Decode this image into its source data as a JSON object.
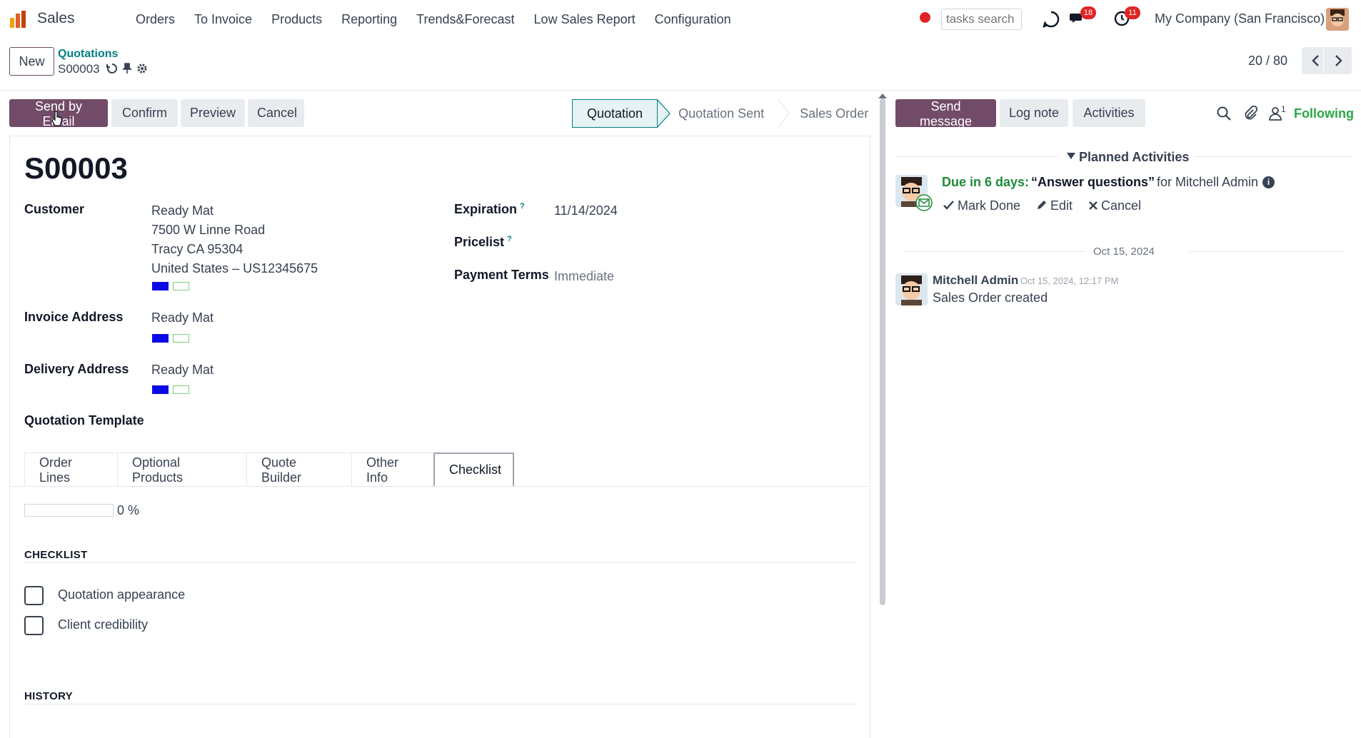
{
  "topnav": {
    "app_name": "Sales",
    "menu": [
      "Orders",
      "To Invoice",
      "Products",
      "Reporting",
      "Trends&Forecast",
      "Low Sales Report",
      "Configuration"
    ],
    "search_placeholder": "tasks search",
    "messages_count": "18",
    "activities_count": "11",
    "company": "My Company (San Francisco)"
  },
  "control_panel": {
    "new_label": "New",
    "breadcrumb_parent": "Quotations",
    "breadcrumb_record": "S00003",
    "pager_value": "20 / 80"
  },
  "actions": {
    "send_by_email": "Send by Email",
    "confirm": "Confirm",
    "preview": "Preview",
    "cancel": "Cancel"
  },
  "statusbar": {
    "stages": [
      "Quotation",
      "Quotation Sent",
      "Sales Order"
    ],
    "active": "Quotation"
  },
  "form": {
    "name": "S00003",
    "customer_label": "Customer",
    "customer_lines": [
      "Ready Mat",
      "7500 W Linne Road",
      "Tracy CA 95304",
      "United States – US12345675"
    ],
    "invoice_label": "Invoice Address",
    "invoice_value": "Ready Mat",
    "delivery_label": "Delivery Address",
    "delivery_value": "Ready Mat",
    "template_label": "Quotation Template",
    "expiration_label": "Expiration",
    "expiration_value": "11/14/2024",
    "pricelist_label": "Pricelist",
    "payment_terms_label": "Payment Terms",
    "payment_terms_value": "Immediate",
    "help_mark": "?",
    "colors": {
      "swatch_blue": "#0a0ae6",
      "swatch_outline": "#7ccf7c"
    }
  },
  "tabs": [
    "Order Lines",
    "Optional Products",
    "Quote Builder",
    "Other Info",
    "Checklist"
  ],
  "active_tab": "Checklist",
  "checklist": {
    "progress_percent": 0,
    "progress_label": "0 %",
    "section_title": "CHECKLIST",
    "items": [
      "Quotation appearance",
      "Client credibility"
    ],
    "history_title": "HISTORY"
  },
  "chatter": {
    "send_message": "Send message",
    "log_note": "Log note",
    "activities": "Activities",
    "followers_count": "1",
    "following": "Following",
    "planned_title": "Planned Activities",
    "due": "Due in 6 days:",
    "activity_summary": "“Answer questions”",
    "activity_user": "for Mitchell Admin",
    "mark_done": "Mark Done",
    "edit": "Edit",
    "cancel": "Cancel",
    "date_separator": "Oct 15, 2024",
    "message_author": "Mitchell Admin",
    "message_date": "Oct 15, 2024, 12:17 PM",
    "message_body": "Sales Order created"
  },
  "theme": {
    "brand": "#714b67",
    "accent": "#017e84",
    "success": "#28a745",
    "danger": "#e02424"
  }
}
